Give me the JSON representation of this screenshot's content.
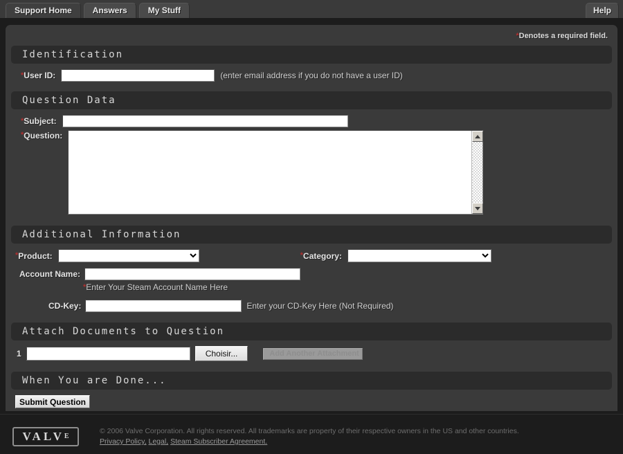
{
  "nav": {
    "tabs": [
      {
        "label": "Support Home",
        "active": true
      },
      {
        "label": "Answers",
        "active": false
      },
      {
        "label": "My Stuff",
        "active": false
      }
    ],
    "help_label": "Help"
  },
  "required_note": "Denotes a required field.",
  "sections": {
    "identification": {
      "title": "Identification",
      "user_id_label": "User ID:",
      "user_id_value": "",
      "user_id_hint": "(enter email address if you do not have a user ID)"
    },
    "question_data": {
      "title": "Question Data",
      "subject_label": "Subject:",
      "subject_value": "",
      "question_label": "Question:",
      "question_value": ""
    },
    "additional_information": {
      "title": "Additional Information",
      "product_label": "Product:",
      "product_value": "",
      "category_label": "Category:",
      "category_value": "",
      "account_name_label": "Account Name:",
      "account_name_value": "",
      "account_name_hint": "Enter Your Steam Account Name Here",
      "cd_key_label": "CD-Key:",
      "cd_key_value": "",
      "cd_key_hint": "Enter your CD-Key Here (Not Required)"
    },
    "attachments": {
      "title": "Attach Documents to Question",
      "row_number": "1",
      "file_value": "",
      "browse_label": "Choisir...",
      "add_another_label": "Add Another Attachment"
    },
    "done": {
      "title": "When You are Done...",
      "submit_label": "Submit Question"
    }
  },
  "footer": {
    "logo_main": "VALV",
    "logo_sup": "E",
    "copyright": "© 2006 Valve Corporation. All rights reserved. All trademarks are property of their respective owners in the US and other countries.",
    "links": [
      {
        "label": "Privacy Policy,"
      },
      {
        "label": "Legal,"
      },
      {
        "label": "Steam Subscriber Agreement."
      }
    ]
  },
  "colors": {
    "page_bg": "#1c1c1c",
    "panel_bg": "#3a3a3a",
    "section_header_bg": "#2b2b2b",
    "required_star": "#b03030",
    "text": "#e4e4e4"
  }
}
